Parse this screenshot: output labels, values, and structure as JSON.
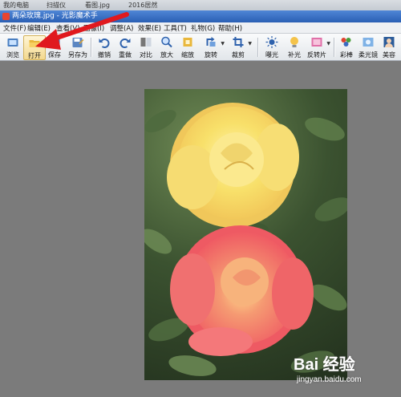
{
  "taskbar": {
    "items": [
      "我的电脑",
      "扫描仪",
      "看图.jpg",
      "2016居然"
    ]
  },
  "window": {
    "title": "两朵玫瑰.jpg - 光影魔术手"
  },
  "menubar": {
    "items": [
      "文件(F)",
      "编辑(E)",
      "查看(V)",
      "图像(I)",
      "调整(A)",
      "效果(E)",
      "工具(T)",
      "礼物(G)",
      "帮助(H)"
    ]
  },
  "toolbar": {
    "browse": "浏览",
    "open": "打开",
    "save": "保存",
    "save_as": "另存为",
    "undo": "撤销",
    "redo": "重做",
    "contrast": "对比",
    "zoom_in": "放大",
    "shrink": "缩放",
    "rotate": "旋转",
    "crop": "裁剪",
    "exposure": "曝光",
    "fill_light": "补光",
    "negative": "反转片",
    "color": "彩棒",
    "soft_focus": "柔光镜",
    "beauty": "美容"
  },
  "watermark": {
    "logo": "Bai 经验",
    "url": "jingyan.baidu.com"
  },
  "colors": {
    "titlebar": "#2a5fb4",
    "workspace": "#7b7b7b",
    "arrow": "#e0191e",
    "hot_tool": "#f3d98e"
  }
}
